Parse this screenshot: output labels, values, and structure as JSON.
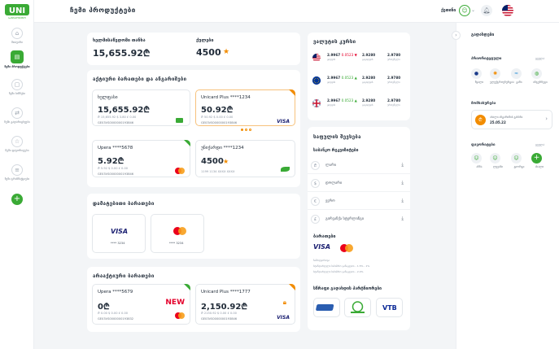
{
  "colors": {
    "brand": "#3aaa35",
    "accent_orange": "#f28c00",
    "visa_blue": "#1a1f71"
  },
  "sidebar": {
    "logo_sub": "ᲡᲐᲓᲔᲞᲝᲖᲘᲢᲝ",
    "items": [
      {
        "label": "მთავარი",
        "icon": "home-icon"
      },
      {
        "label": "ჩემი პროდუქტები",
        "icon": "wallet-icon"
      },
      {
        "label": "ჩემი ბიზნესი",
        "icon": "document-icon"
      },
      {
        "label": "ჩემი გადარიცხვები",
        "icon": "transfer-icon"
      },
      {
        "label": "ჩემი ფავორიტები",
        "icon": "star-icon"
      },
      {
        "label": "ჩემი ტრანზაქციები",
        "icon": "list-icon"
      }
    ]
  },
  "header": {
    "title": "ჩემი პროდუქტები",
    "user_name": "ქეთინი"
  },
  "balance": {
    "available_label": "ხელმისაწვდომი თანხა",
    "available_value": "15,655.92₾",
    "points_label": "ქულები",
    "points_value": "4500"
  },
  "active_cards": {
    "title": "აქტიური ბარათები და ანგარიშები",
    "items": [
      {
        "name": "ხელფასი",
        "amount": "15,655.92₾",
        "sub": "₾ 15,655.92  $ 3.80  £ 0.00",
        "iban": "GE03VS0000000193846"
      },
      {
        "name": "Unicard Plus ****1234",
        "amount": "50.92₾",
        "sub": "₾ 50.92  $ 0.00  £ 0.00",
        "iban": "GE03VS0000000193846",
        "brand": "VISA"
      },
      {
        "name": "Upera ****5678",
        "amount": "5.92₾",
        "sub": "₾ 5.92  $ 0.00  £ 0.00",
        "iban": "GE03VS0000000193846"
      },
      {
        "name": "უნიქარდი ****1234",
        "amount": "4500",
        "sub": "1199 1134 XXXX XXXX"
      }
    ]
  },
  "linked_cards": {
    "title": "დამატებითი ბარათები",
    "items": [
      {
        "brand": "VISA",
        "number": "**** 3234"
      },
      {
        "brand": "mastercard",
        "number": "**** 3234"
      }
    ]
  },
  "inactive_cards": {
    "title": "არააქტიური ბარათები",
    "items": [
      {
        "name": "Upera ****5679",
        "amount": "0₾",
        "sub": "₾ 0.00  $ 0.00  £ 0.00",
        "iban": "GE03VS0000000193832",
        "badge": "NEW"
      },
      {
        "name": "Unicard Plus ****1777",
        "amount": "2,150.92₾",
        "sub": "₾ 2150.92  $ 0.00  £ 0.00",
        "iban": "GE03VS0000000193846",
        "brand": "VISA"
      }
    ]
  },
  "rates": {
    "title": "ვალუტის კურსი",
    "rows": [
      {
        "flag": "us-flag",
        "buy": "2.9967",
        "change": "0.0523 ▼",
        "sell": "2.9280",
        "nbg": "2.9780",
        "buy_lbl": "ყიდვის",
        "sell_lbl": "გაყიდვის",
        "nbg_lbl": "ეროვნული"
      },
      {
        "flag": "eu-flag",
        "buy": "2.9967",
        "change": "0.0523 ▲",
        "sell": "2.9280",
        "nbg": "2.9780",
        "buy_lbl": "ყიდვის",
        "sell_lbl": "გაყიდვის",
        "nbg_lbl": "ეროვნული"
      },
      {
        "flag": "gb-flag",
        "buy": "2.9967",
        "change": "0.0523 ▲",
        "sell": "2.9280",
        "nbg": "2.9780",
        "buy_lbl": "ყიდვის",
        "sell_lbl": "გაყიდვის",
        "nbg_lbl": "ეროვნული"
      }
    ]
  },
  "services": {
    "title": "საფულის შევსება",
    "subtitle": "საბანკო რეკვიზიტები",
    "items": [
      {
        "label": "ლარი",
        "icon": "₾"
      },
      {
        "label": "დოლარი",
        "icon": "$"
      },
      {
        "label": "ევრო",
        "icon": "€"
      },
      {
        "label": "გირვანქა სტერლინგი",
        "icon": "£"
      }
    ]
  },
  "card_fees": {
    "title": "ბარათები",
    "line1": "ჩამოტვირთვა",
    "line2": "სტანდარტული საბაზრო განაკვეთი – 1.5% - 1%",
    "line3": "სტანდარტული საბაზრო განაკვეთი – 2.4%"
  },
  "partners": {
    "title": "სწრაფი გადახდის პარტნიორები",
    "items": [
      "Liberty",
      "GPSB",
      "VTB"
    ]
  },
  "right_panel": {
    "title": "გადახდები",
    "templates_title": "პრიორიტეტული",
    "templates_more": "ყველა",
    "templates": [
      {
        "label": "წყალი"
      },
      {
        "label": "ელექტროენერგია"
      },
      {
        "label": "გაზი"
      },
      {
        "label": "ინტერნეტი"
      }
    ],
    "loan_title": "მომსახურება",
    "loan_item": "ახალი ანგარიშის გახსნა",
    "loan_sub": "25.05.22",
    "favorites_title": "ფავორიტები",
    "favorites_more": "ყველა",
    "favorites": [
      {
        "label": "ანნა"
      },
      {
        "label": "ლევანი"
      },
      {
        "label": "გიორგი"
      },
      {
        "label": "ახალი"
      }
    ]
  }
}
